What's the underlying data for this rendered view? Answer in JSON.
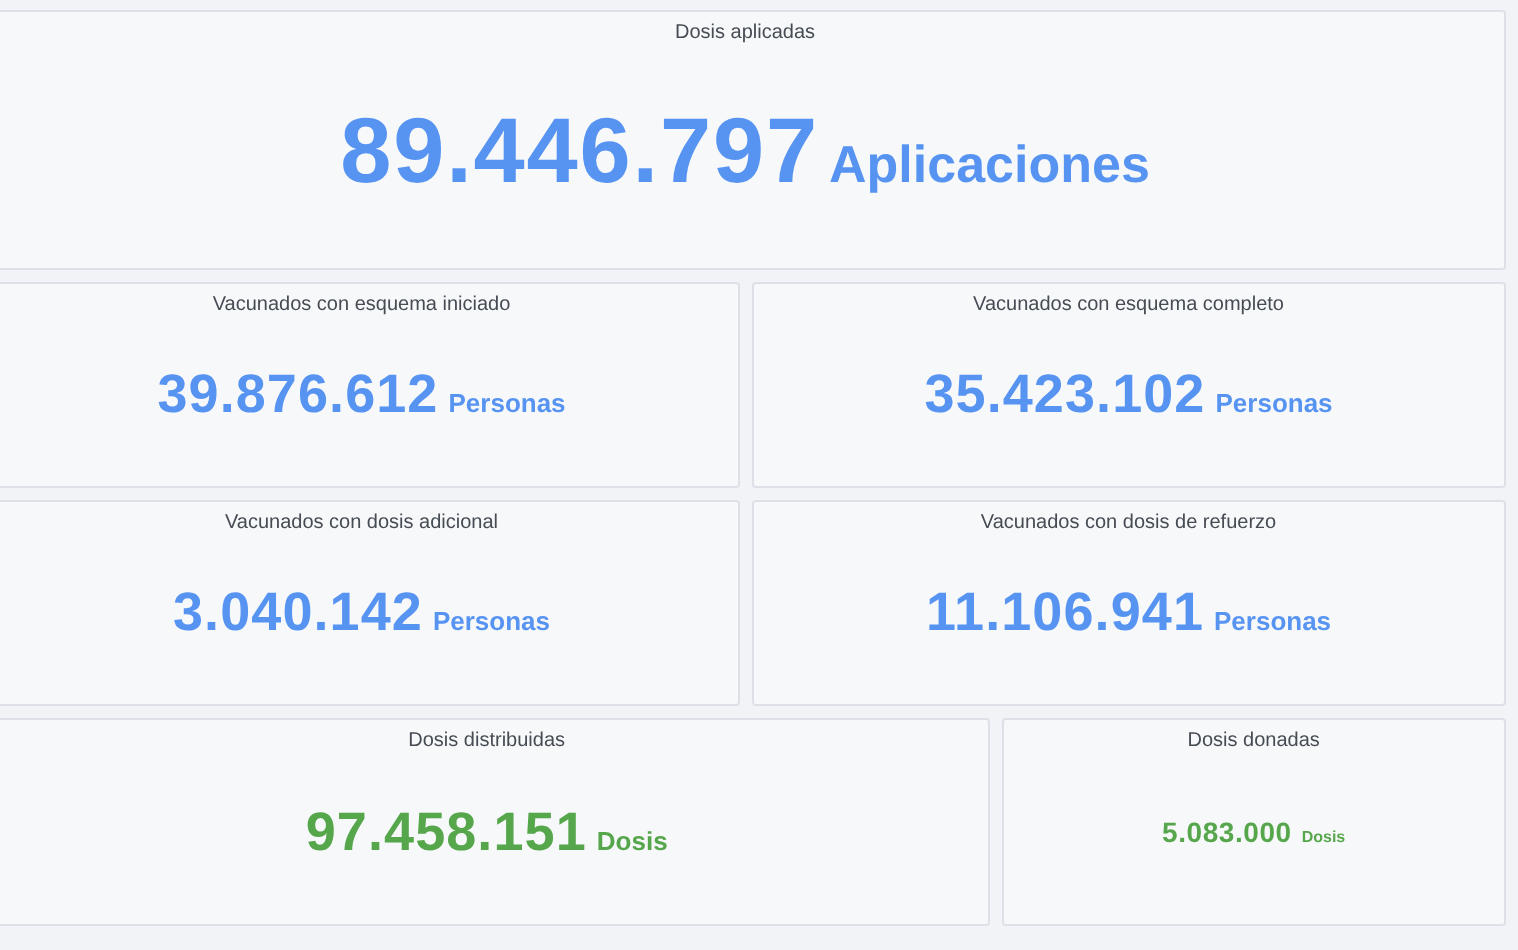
{
  "rows": [
    {
      "panels": [
        {
          "title": "Dosis aplicadas",
          "value": "89.446.797",
          "unit": "Aplicaciones",
          "kind": "hero",
          "color": "#5794f2"
        }
      ]
    },
    {
      "panels": [
        {
          "title": "Vacunados con esquema iniciado",
          "value": "39.876.612",
          "unit": "Personas",
          "kind": "stat",
          "color": "#5794f2"
        },
        {
          "title": "Vacunados con esquema completo",
          "value": "35.423.102",
          "unit": "Personas",
          "kind": "stat",
          "color": "#5794f2"
        }
      ]
    },
    {
      "panels": [
        {
          "title": "Vacunados con dosis adicional",
          "value": "3.040.142",
          "unit": "Personas",
          "kind": "stat",
          "color": "#5794f2"
        },
        {
          "title": "Vacunados con dosis de refuerzo",
          "value": "11.106.941",
          "unit": "Personas",
          "kind": "stat",
          "color": "#5794f2"
        }
      ]
    },
    {
      "panels": [
        {
          "title": "Dosis distribuidas",
          "value": "97.458.151",
          "unit": "Dosis",
          "kind": "stat",
          "color": "#56a64b"
        },
        {
          "title": "Dosis donadas",
          "value": "5.083.000",
          "unit": "Dosis",
          "kind": "mini",
          "color": "#56a64b"
        }
      ]
    }
  ]
}
